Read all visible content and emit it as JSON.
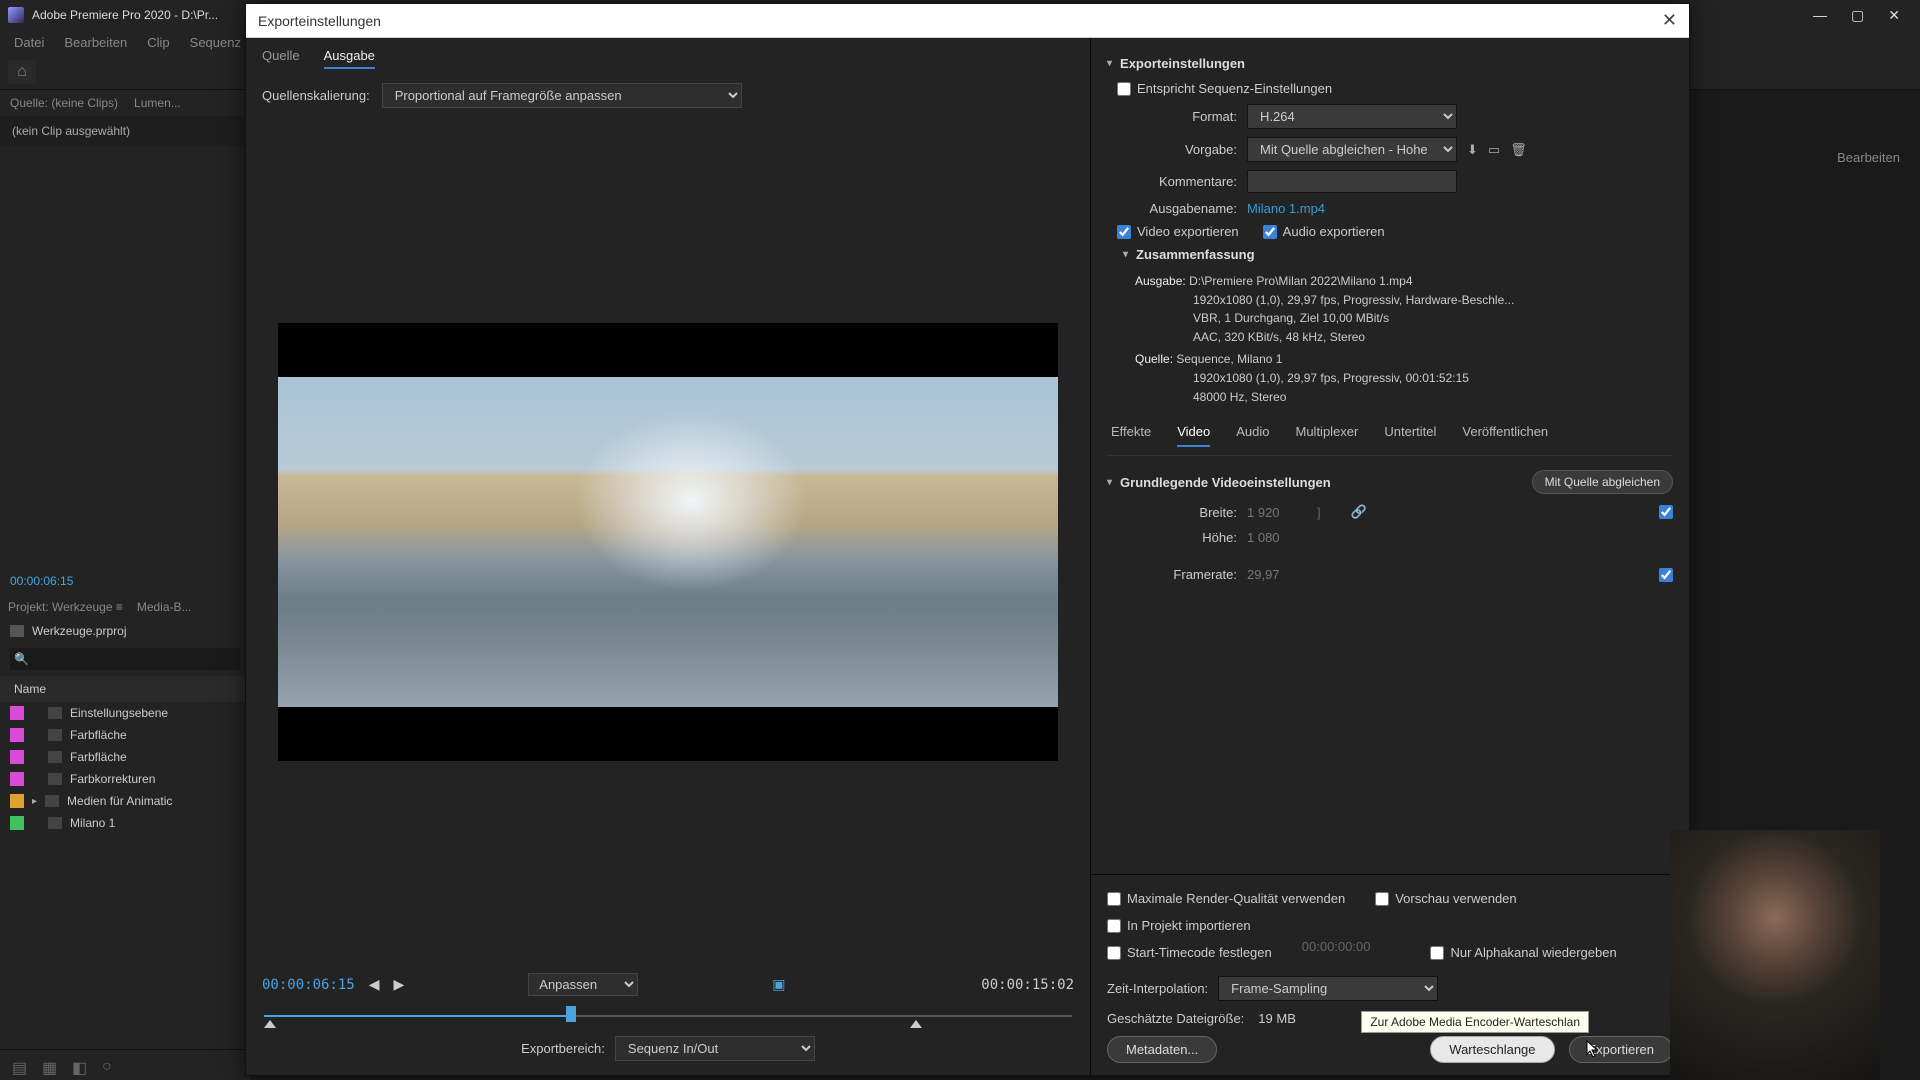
{
  "app": {
    "title": "Adobe Premiere Pro 2020 - D:\\Pr...",
    "menus": [
      "Datei",
      "Bearbeiten",
      "Clip",
      "Sequenz"
    ]
  },
  "bg": {
    "source_tabs": [
      "Quelle: (keine Clips)",
      "Lumen..."
    ],
    "no_clip": "(kein Clip ausgewählt)",
    "timecode": "00:00:06:15",
    "proj_tabs": [
      "Projekt: Werkzeuge  ≡",
      "Media-B..."
    ],
    "project_file": "Werkzeuge.prproj",
    "col_name": "Name",
    "assets": [
      {
        "color": "#d94ad9",
        "label": "Einstellungsebene"
      },
      {
        "color": "#d94ad9",
        "label": "Farbfläche"
      },
      {
        "color": "#d94ad9",
        "label": "Farbfläche"
      },
      {
        "color": "#d94ad9",
        "label": "Farbkorrekturen"
      },
      {
        "color": "#e0a030",
        "label": "Medien für Animatic",
        "expand": true
      },
      {
        "color": "#40c060",
        "label": "Milano 1"
      }
    ],
    "right_tab": "Bearbeiten"
  },
  "dialog": {
    "title": "Exporteinstellungen",
    "src_tabs": {
      "quelle": "Quelle",
      "ausgabe": "Ausgabe"
    },
    "scale_label": "Quellenskalierung:",
    "scale_value": "Proportional auf Framegröße anpassen",
    "tc_current": "00:00:06:15",
    "tc_duration": "00:00:15:02",
    "fit": "Anpassen",
    "range_label": "Exportbereich:",
    "range_value": "Sequenz In/Out"
  },
  "export": {
    "section": "Exporteinstellungen",
    "match_seq": "Entspricht Sequenz-Einstellungen",
    "format_label": "Format:",
    "format_value": "H.264",
    "preset_label": "Vorgabe:",
    "preset_value": "Mit Quelle abgleichen - Hohe B...",
    "comments_label": "Kommentare:",
    "outname_label": "Ausgabename:",
    "outname_value": "Milano 1.mp4",
    "export_video": "Video exportieren",
    "export_audio": "Audio exportieren",
    "summary_head": "Zusammenfassung",
    "summary": {
      "out_k": "Ausgabe:",
      "out_l1": "D:\\Premiere Pro\\Milan 2022\\Milano 1.mp4",
      "out_l2": "1920x1080 (1,0), 29,97 fps, Progressiv, Hardware-Beschle...",
      "out_l3": "VBR, 1 Durchgang, Ziel 10,00 MBit/s",
      "out_l4": "AAC, 320 KBit/s, 48 kHz, Stereo",
      "src_k": "Quelle:",
      "src_l1": "Sequence, Milano 1",
      "src_l2": "1920x1080 (1,0), 29,97 fps, Progressiv, 00:01:52:15",
      "src_l3": "48000 Hz, Stereo"
    },
    "tabs": [
      "Effekte",
      "Video",
      "Audio",
      "Multiplexer",
      "Untertitel",
      "Veröffentlichen"
    ],
    "basic_head": "Grundlegende Videoeinstellungen",
    "match_source_btn": "Mit Quelle abgleichen",
    "width_label": "Breite:",
    "width_value": "1 920",
    "height_label": "Höhe:",
    "height_value": "1 080",
    "fps_label": "Framerate:",
    "fps_value": "29,97"
  },
  "bottom": {
    "max_quality": "Maximale Render-Qualität verwenden",
    "use_preview": "Vorschau verwenden",
    "import_project": "In Projekt importieren",
    "set_start_tc": "Start-Timecode festlegen",
    "start_tc_value": "00:00:00:00",
    "alpha_only": "Nur Alphakanal wiedergeben",
    "interp_label": "Zeit-Interpolation:",
    "interp_value": "Frame-Sampling",
    "est_label": "Geschätzte Dateigröße:",
    "est_value": "19 MB",
    "metadata_btn": "Metadaten...",
    "queue_btn": "Warteschlange",
    "export_btn": "Exportieren",
    "tooltip": "Zur Adobe Media Encoder-Warteschlan"
  }
}
